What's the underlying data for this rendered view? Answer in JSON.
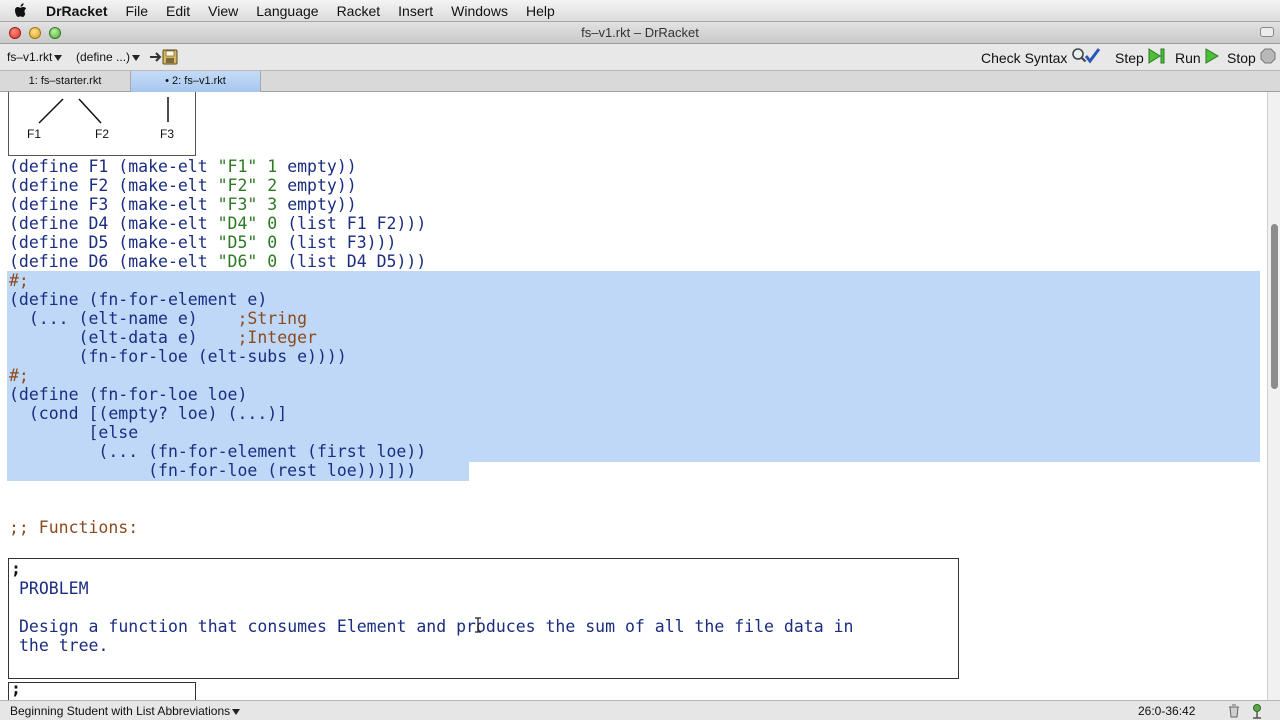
{
  "menubar": {
    "app_name": "DrRacket",
    "items": [
      "File",
      "Edit",
      "View",
      "Language",
      "Racket",
      "Insert",
      "Windows",
      "Help"
    ]
  },
  "window": {
    "title": "fs–v1.rkt – DrRacket"
  },
  "toolbar": {
    "file_popup": "fs–v1.rkt",
    "define_popup": "(define ...)",
    "check_syntax_label": "Check Syntax",
    "step_label": "Step",
    "run_label": "Run",
    "stop_label": "Stop"
  },
  "tabs": [
    {
      "label": "1: fs–starter.rkt",
      "active": false
    },
    {
      "label": "• 2: fs–v1.rkt",
      "active": true
    }
  ],
  "editor": {
    "tree_labels": [
      "F1",
      "F2",
      "F3"
    ],
    "defines": [
      {
        "head": "(define F1 (make-elt ",
        "str": "\"F1\"",
        "num": " 1 ",
        "tail": "empty))"
      },
      {
        "head": "(define F2 (make-elt ",
        "str": "\"F2\"",
        "num": " 2 ",
        "tail": "empty))"
      },
      {
        "head": "(define F3 (make-elt ",
        "str": "\"F3\"",
        "num": " 3 ",
        "tail": "empty))"
      },
      {
        "head": "(define D4 (make-elt ",
        "str": "\"D4\"",
        "num": " 0 ",
        "tail": "(list F1 F2)))"
      },
      {
        "head": "(define D5 (make-elt ",
        "str": "\"D5\"",
        "num": " 0 ",
        "tail": "(list F3)))"
      },
      {
        "head": "(define D6 (make-elt ",
        "str": "\"D6\"",
        "num": " 0 ",
        "tail": "(list D4 D5)))"
      }
    ],
    "template_element": {
      "comment_marker": "#;",
      "line1": "(define (fn-for-element e)",
      "line2_code": "  (... (elt-name e)    ",
      "line2_comment": ";String",
      "line3_code": "       (elt-data e)    ",
      "line3_comment": ";Integer",
      "line4": "       (fn-for-loe (elt-subs e))))"
    },
    "template_loe": {
      "comment_marker": "#;",
      "line1": "(define (fn-for-loe loe)",
      "line2": "  (cond [(empty? loe) (...)]",
      "line3": "        [else",
      "line4": "         (... (fn-for-element (first loe))",
      "line5": "              (fn-for-loe (rest loe)))]))"
    },
    "functions_comment": ";; Functions:",
    "problem": {
      "marker": ";",
      "heading": "PROBLEM",
      "text_line1": "Design a function that consumes Element and produces the sum of all the file data in",
      "text_line2": "the tree."
    },
    "next_marker": ";"
  },
  "statusbar": {
    "language": "Beginning Student with List Abbreviations",
    "position": "26:0-36:42"
  }
}
